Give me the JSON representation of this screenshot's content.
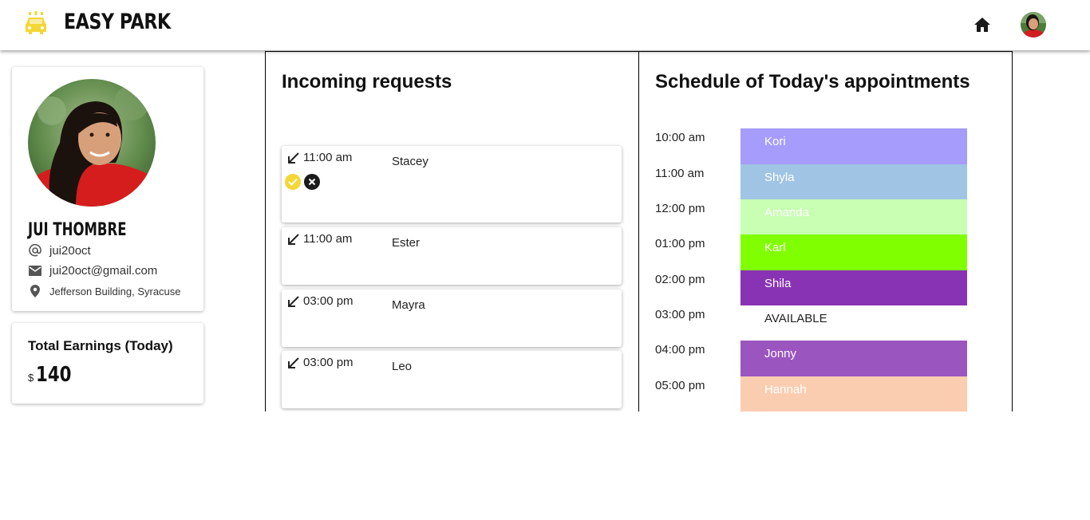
{
  "header": {
    "app_name": "EASY PARK",
    "brand_icon": "taxi-icon",
    "home_icon": "home-icon",
    "brand_color": "#f3d734"
  },
  "profile": {
    "name": "JUI THOMBRE",
    "username": "jui20oct",
    "email": "jui20oct@gmail.com",
    "location": "Jefferson Building, Syracuse"
  },
  "earnings": {
    "title": "Total Earnings (Today)",
    "currency": "$",
    "amount": "140"
  },
  "requests": {
    "title": "Incoming requests",
    "items": [
      {
        "time": "11:00 am",
        "name": "Stacey",
        "actions": true
      },
      {
        "time": "11:00 am",
        "name": "Ester",
        "actions": false
      },
      {
        "time": "03:00 pm",
        "name": "Mayra",
        "actions": false
      },
      {
        "time": "03:00 pm",
        "name": "Leo",
        "actions": false
      }
    ]
  },
  "schedule": {
    "title": "Schedule of Today's appointments",
    "slots": [
      {
        "time": "10:00 am",
        "name": "Kori",
        "color": "#a59cfb"
      },
      {
        "time": "11:00 am",
        "name": "Shyla",
        "color": "#a0c4e3"
      },
      {
        "time": "12:00 pm",
        "name": "Amanda",
        "color": "#c8ffb3"
      },
      {
        "time": "01:00 pm",
        "name": "Karl",
        "color": "#80ff00"
      },
      {
        "time": "02:00 pm",
        "name": "Shila",
        "color": "#8833b4"
      },
      {
        "time": "03:00 pm",
        "name": "AVAILABLE",
        "color": "#ffffff"
      },
      {
        "time": "04:00 pm",
        "name": "Jonny",
        "color": "#9b55bf"
      },
      {
        "time": "05:00 pm",
        "name": "Hannah",
        "color": "#fbcdb0"
      }
    ]
  }
}
